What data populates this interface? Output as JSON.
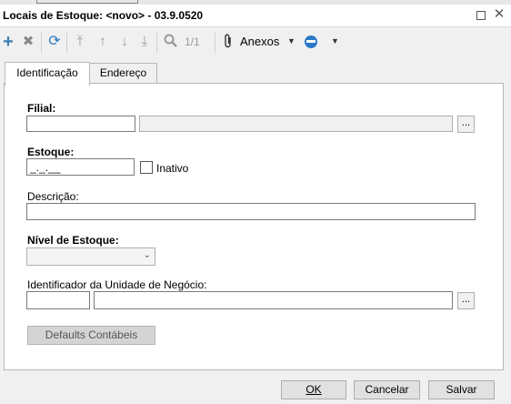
{
  "window": {
    "title": "Locais de Estoque: <novo> - 03.9.0520"
  },
  "toolbar": {
    "pager": "1/1",
    "anexos_label": "Anexos"
  },
  "tabs": [
    {
      "label": "Identificação"
    },
    {
      "label": "Endereço"
    }
  ],
  "form": {
    "filial_label": "Filial:",
    "filial_code": "",
    "filial_name": "",
    "estoque_label": "Estoque:",
    "estoque_value": "_._.__",
    "inativo_label": "Inativo",
    "descricao_label": "Descrição:",
    "descricao_value": "",
    "nivel_label": "Nível de Estoque:",
    "nivel_value": "",
    "unidade_label": "Identificador da Unidade de Negócio:",
    "unidade_code": "",
    "unidade_name": "",
    "ellipsis": "...",
    "defaults_label": "Defaults Contábeis"
  },
  "footer": {
    "ok_label": "OK",
    "cancel_label": "Cancelar",
    "save_label": "Salvar"
  }
}
